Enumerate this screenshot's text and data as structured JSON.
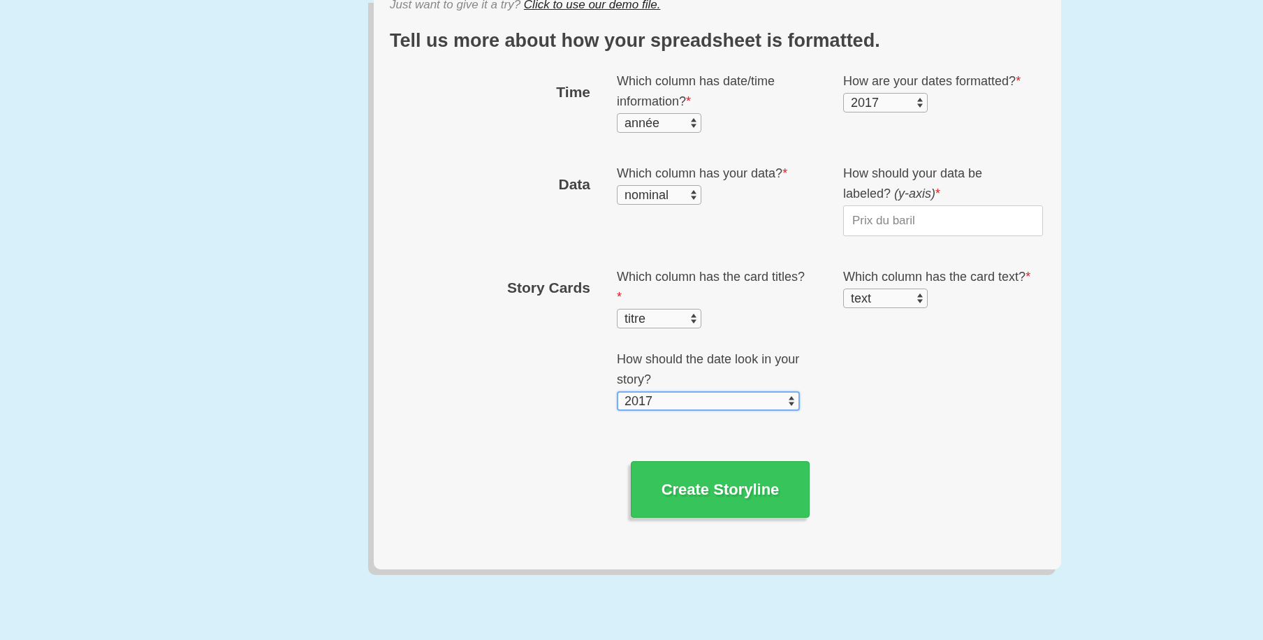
{
  "intro": {
    "text": "Just want to give it a try?",
    "link": "Click to use our demo file."
  },
  "heading": "Tell us more about how your spreadsheet is formatted.",
  "sections": [
    {
      "label": "Time",
      "fields": [
        {
          "kind": "select",
          "label": "Which column has date/time information?",
          "required_mark": "*",
          "value": "année",
          "focused": false,
          "wide": false
        },
        {
          "kind": "select",
          "label": "How are your dates formatted?",
          "required_mark": "*",
          "value": "2017",
          "focused": false,
          "wide": false
        }
      ]
    },
    {
      "label": "Data",
      "fields": [
        {
          "kind": "select",
          "label": "Which column has your data?",
          "required_mark": "*",
          "value": "nominal",
          "focused": false,
          "wide": false
        },
        {
          "kind": "text",
          "label": "How should your data be labeled? *(y-axis)*",
          "required_mark": "*",
          "placeholder": "Prix du baril",
          "focused": false
        }
      ]
    },
    {
      "label": "Story Cards",
      "fields": [
        {
          "kind": "select",
          "label": "Which column has the card titles?",
          "required_mark": "*",
          "value": "titre",
          "focused": false,
          "wide": false
        },
        {
          "kind": "select",
          "label": "Which column has the card text?",
          "required_mark": "*",
          "value": "text",
          "focused": false,
          "wide": false
        },
        {
          "kind": "select",
          "label": "How should the date look in your story?",
          "value": "2017",
          "focused": true,
          "wide": true
        }
      ]
    }
  ],
  "button": "Create Storyline"
}
